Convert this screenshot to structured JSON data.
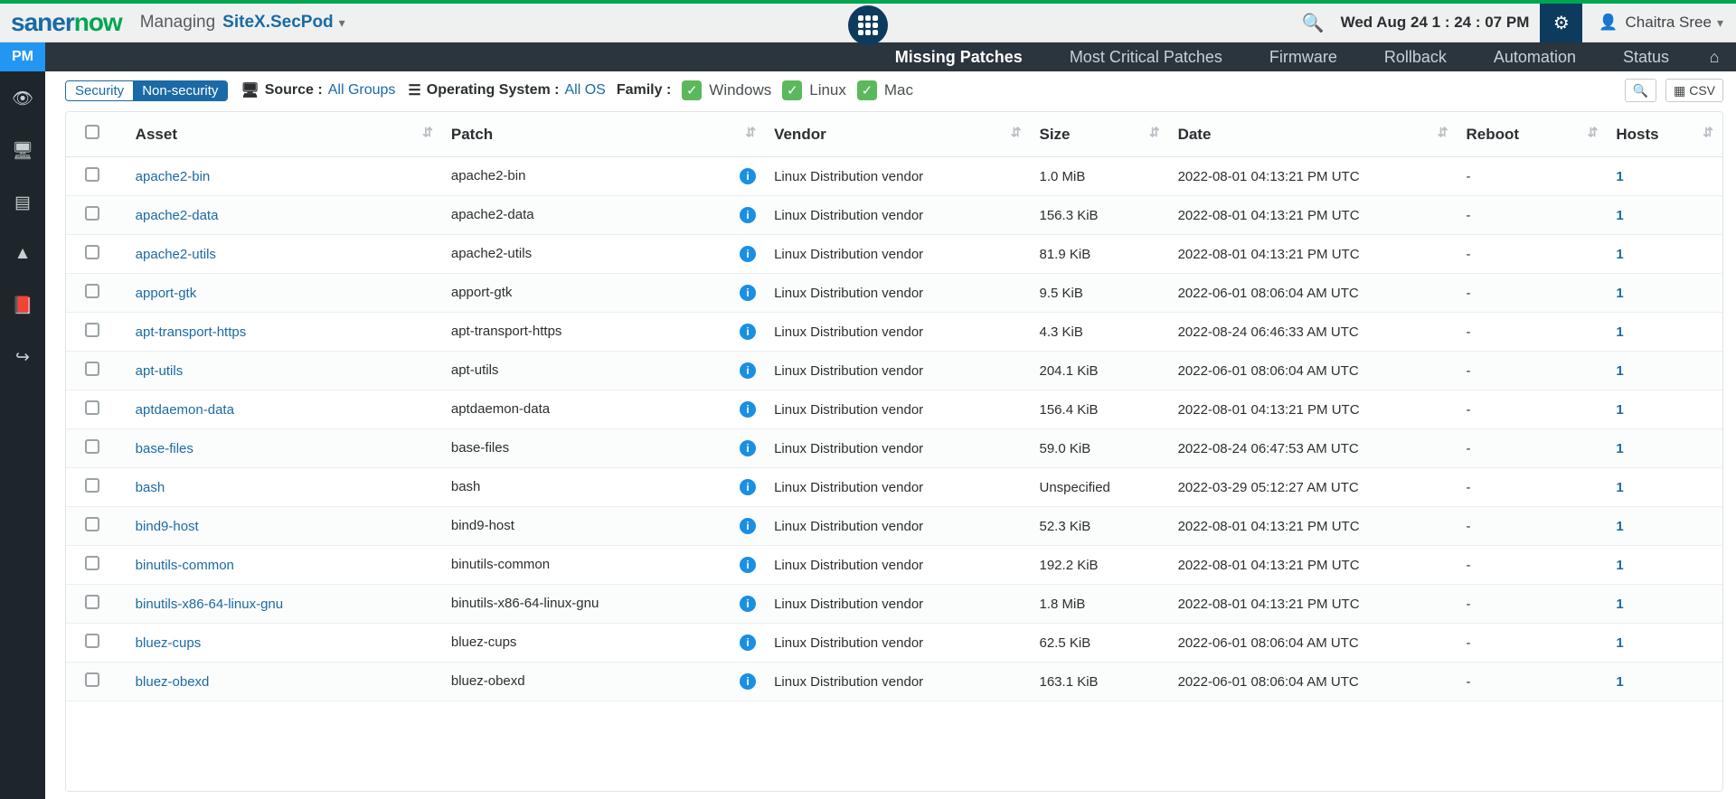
{
  "brand": {
    "p1": "saner",
    "p2": "now"
  },
  "header": {
    "managing_label": "Managing",
    "site": "SiteX.SecPod",
    "datetime": "Wed Aug 24  1 : 24 : 07 PM",
    "user": "Chaitra Sree"
  },
  "nav": {
    "pm": "PM",
    "items": [
      "Missing Patches",
      "Most Critical Patches",
      "Firmware",
      "Rollback",
      "Automation",
      "Status"
    ],
    "active_index": 0
  },
  "filters": {
    "security": "Security",
    "non_security": "Non-security",
    "source_label": "Source :",
    "source_value": "All Groups",
    "os_label": "Operating System :",
    "os_value": "All OS",
    "family_label": "Family :",
    "family_options": [
      "Windows",
      "Linux",
      "Mac"
    ],
    "csv": "CSV"
  },
  "columns": {
    "asset": "Asset",
    "patch": "Patch",
    "vendor": "Vendor",
    "size": "Size",
    "date": "Date",
    "reboot": "Reboot",
    "hosts": "Hosts"
  },
  "rows": [
    {
      "asset": "apache2-bin",
      "patch": "apache2-bin",
      "vendor": "Linux Distribution vendor",
      "size": "1.0 MiB",
      "date": "2022-08-01 04:13:21 PM UTC",
      "reboot": "-",
      "hosts": "1"
    },
    {
      "asset": "apache2-data",
      "patch": "apache2-data",
      "vendor": "Linux Distribution vendor",
      "size": "156.3 KiB",
      "date": "2022-08-01 04:13:21 PM UTC",
      "reboot": "-",
      "hosts": "1"
    },
    {
      "asset": "apache2-utils",
      "patch": "apache2-utils",
      "vendor": "Linux Distribution vendor",
      "size": "81.9 KiB",
      "date": "2022-08-01 04:13:21 PM UTC",
      "reboot": "-",
      "hosts": "1"
    },
    {
      "asset": "apport-gtk",
      "patch": "apport-gtk",
      "vendor": "Linux Distribution vendor",
      "size": "9.5 KiB",
      "date": "2022-06-01 08:06:04 AM UTC",
      "reboot": "-",
      "hosts": "1"
    },
    {
      "asset": "apt-transport-https",
      "patch": "apt-transport-https",
      "vendor": "Linux Distribution vendor",
      "size": "4.3 KiB",
      "date": "2022-08-24 06:46:33 AM UTC",
      "reboot": "-",
      "hosts": "1"
    },
    {
      "asset": "apt-utils",
      "patch": "apt-utils",
      "vendor": "Linux Distribution vendor",
      "size": "204.1 KiB",
      "date": "2022-06-01 08:06:04 AM UTC",
      "reboot": "-",
      "hosts": "1"
    },
    {
      "asset": "aptdaemon-data",
      "patch": "aptdaemon-data",
      "vendor": "Linux Distribution vendor",
      "size": "156.4 KiB",
      "date": "2022-08-01 04:13:21 PM UTC",
      "reboot": "-",
      "hosts": "1"
    },
    {
      "asset": "base-files",
      "patch": "base-files",
      "vendor": "Linux Distribution vendor",
      "size": "59.0 KiB",
      "date": "2022-08-24 06:47:53 AM UTC",
      "reboot": "-",
      "hosts": "1"
    },
    {
      "asset": "bash",
      "patch": "bash",
      "vendor": "Linux Distribution vendor",
      "size": "Unspecified",
      "date": "2022-03-29 05:12:27 AM UTC",
      "reboot": "-",
      "hosts": "1"
    },
    {
      "asset": "bind9-host",
      "patch": "bind9-host",
      "vendor": "Linux Distribution vendor",
      "size": "52.3 KiB",
      "date": "2022-08-01 04:13:21 PM UTC",
      "reboot": "-",
      "hosts": "1"
    },
    {
      "asset": "binutils-common",
      "patch": "binutils-common",
      "vendor": "Linux Distribution vendor",
      "size": "192.2 KiB",
      "date": "2022-08-01 04:13:21 PM UTC",
      "reboot": "-",
      "hosts": "1"
    },
    {
      "asset": "binutils-x86-64-linux-gnu",
      "patch": "binutils-x86-64-linux-gnu",
      "vendor": "Linux Distribution vendor",
      "size": "1.8 MiB",
      "date": "2022-08-01 04:13:21 PM UTC",
      "reboot": "-",
      "hosts": "1"
    },
    {
      "asset": "bluez-cups",
      "patch": "bluez-cups",
      "vendor": "Linux Distribution vendor",
      "size": "62.5 KiB",
      "date": "2022-06-01 08:06:04 AM UTC",
      "reboot": "-",
      "hosts": "1"
    },
    {
      "asset": "bluez-obexd",
      "patch": "bluez-obexd",
      "vendor": "Linux Distribution vendor",
      "size": "163.1 KiB",
      "date": "2022-06-01 08:06:04 AM UTC",
      "reboot": "-",
      "hosts": "1"
    }
  ]
}
